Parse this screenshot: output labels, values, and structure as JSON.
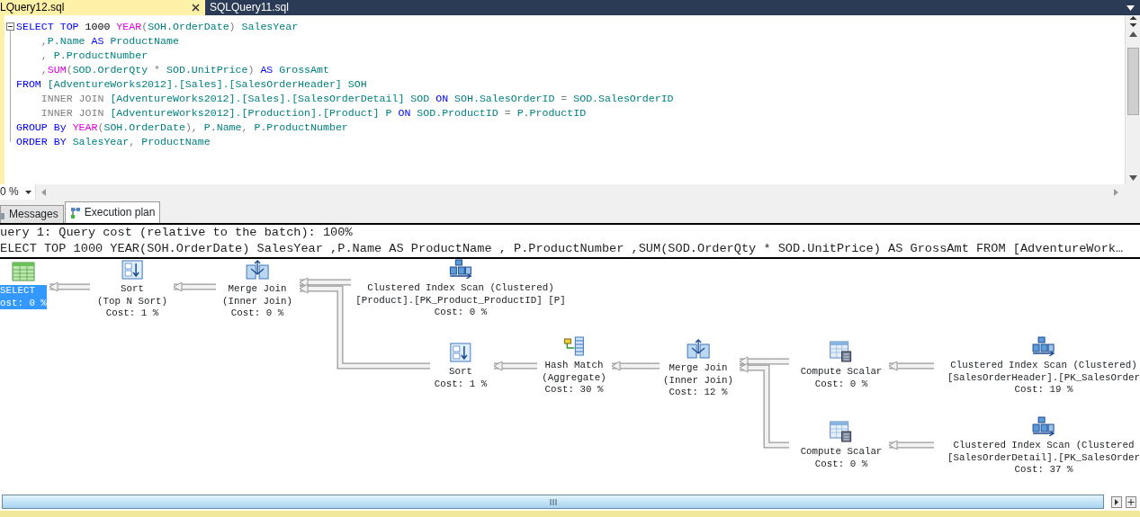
{
  "document_tabs": [
    {
      "label": "LQuery12.sql",
      "selected": true
    },
    {
      "label": "SQLQuery11.sql",
      "selected": false
    }
  ],
  "editor": {
    "lines": [
      [
        {
          "kind": "keyword",
          "text": "SELECT TOP "
        },
        {
          "kind": "plain",
          "text": "1000 "
        },
        {
          "kind": "function",
          "text": "YEAR"
        },
        {
          "kind": "punct",
          "text": "("
        },
        {
          "kind": "ident",
          "text": "SOH.OrderDate"
        },
        {
          "kind": "punct",
          "text": ")"
        },
        {
          "kind": "ident",
          "text": " SalesYear"
        }
      ],
      [
        {
          "kind": "punct",
          "text": "    ,"
        },
        {
          "kind": "ident",
          "text": "P.Name "
        },
        {
          "kind": "keyword",
          "text": "AS "
        },
        {
          "kind": "ident",
          "text": "ProductName"
        }
      ],
      [
        {
          "kind": "punct",
          "text": "    , "
        },
        {
          "kind": "ident",
          "text": "P.ProductNumber"
        }
      ],
      [
        {
          "kind": "punct",
          "text": "    ,"
        },
        {
          "kind": "function",
          "text": "SUM"
        },
        {
          "kind": "punct",
          "text": "("
        },
        {
          "kind": "ident",
          "text": "SOD.OrderQty "
        },
        {
          "kind": "punct",
          "text": "* "
        },
        {
          "kind": "ident",
          "text": "SOD.UnitPrice"
        },
        {
          "kind": "punct",
          "text": ") "
        },
        {
          "kind": "keyword",
          "text": "AS "
        },
        {
          "kind": "ident",
          "text": "GrossAmt"
        }
      ],
      [
        {
          "kind": "keyword",
          "text": "FROM "
        },
        {
          "kind": "ident",
          "text": "[AdventureWorks2012].[Sales].[SalesOrderHeader] SOH"
        }
      ],
      [
        {
          "kind": "punct",
          "text": "    INNER JOIN "
        },
        {
          "kind": "ident",
          "text": "[AdventureWorks2012].[Sales].[SalesOrderDetail] SOD "
        },
        {
          "kind": "keyword",
          "text": "ON "
        },
        {
          "kind": "ident",
          "text": "SOH.SalesOrderID "
        },
        {
          "kind": "punct",
          "text": "= "
        },
        {
          "kind": "ident",
          "text": "SOD.SalesOrderID"
        }
      ],
      [
        {
          "kind": "punct",
          "text": "    INNER JOIN "
        },
        {
          "kind": "ident",
          "text": "[AdventureWorks2012].[Production].[Product] P "
        },
        {
          "kind": "keyword",
          "text": "ON "
        },
        {
          "kind": "ident",
          "text": "SOD.ProductID "
        },
        {
          "kind": "punct",
          "text": "= "
        },
        {
          "kind": "ident",
          "text": "P.ProductID"
        }
      ],
      [
        {
          "kind": "keyword",
          "text": "GROUP By "
        },
        {
          "kind": "function",
          "text": "YEAR"
        },
        {
          "kind": "punct",
          "text": "("
        },
        {
          "kind": "ident",
          "text": "SOH.OrderDate"
        },
        {
          "kind": "punct",
          "text": "), "
        },
        {
          "kind": "ident",
          "text": "P.Name"
        },
        {
          "kind": "punct",
          "text": ", "
        },
        {
          "kind": "ident",
          "text": "P.ProductNumber"
        }
      ],
      [
        {
          "kind": "keyword",
          "text": "ORDER BY "
        },
        {
          "kind": "ident",
          "text": "SalesYear"
        },
        {
          "kind": "punct",
          "text": ", "
        },
        {
          "kind": "ident",
          "text": "ProductName"
        }
      ]
    ]
  },
  "zoom": {
    "value": "0 %"
  },
  "result_tabs": [
    {
      "label": "Messages",
      "selected": false
    },
    {
      "label": "Execution plan",
      "selected": true
    }
  ],
  "plan": {
    "header": [
      "uery 1: Query cost (relative to the batch): 100%",
      "ELECT TOP 1000 YEAR(SOH.OrderDate) SalesYear ,P.Name AS ProductName , P.ProductNumber ,SUM(SOD.OrderQty * SOD.UnitPrice) AS GrossAmt FROM [AdventureWork…"
    ],
    "root": {
      "kind": "select",
      "name": "SELECT",
      "cost": "ost: 0 %",
      "selected": true,
      "children": [
        {
          "kind": "sort",
          "name": "Sort",
          "detail": "(Top N Sort)",
          "cost": "Cost: 1 %",
          "selected": false,
          "children": [
            {
              "kind": "merge_join",
              "name": "Merge Join",
              "detail": "(Inner Join)",
              "cost": "Cost: 0 %",
              "selected": false,
              "children": [
                {
                  "kind": "index_scan",
                  "name": "Clustered Index Scan (Clustered)",
                  "detail": "[Product].[PK_Product_ProductID] [P]",
                  "cost": "Cost: 0 %",
                  "selected": false
                },
                {
                  "kind": "sort",
                  "name": "Sort",
                  "cost": "Cost: 1 %",
                  "selected": false,
                  "children": [
                    {
                      "kind": "hash_match",
                      "name": "Hash Match",
                      "detail": "(Aggregate)",
                      "cost": "Cost: 30 %",
                      "selected": false,
                      "children": [
                        {
                          "kind": "merge_join",
                          "name": "Merge Join",
                          "detail": "(Inner Join)",
                          "cost": "Cost: 12 %",
                          "selected": false,
                          "children": [
                            {
                              "kind": "compute_scalar",
                              "name": "Compute Scalar",
                              "cost": "Cost: 0 %",
                              "selected": false,
                              "children": [
                                {
                                  "kind": "index_scan",
                                  "name": "Clustered Index Scan (Clustered)",
                                  "detail": "[SalesOrderHeader].[PK_SalesOrder",
                                  "cost": "Cost: 19 %",
                                  "selected": false
                                }
                              ]
                            },
                            {
                              "kind": "compute_scalar",
                              "name": "Compute Scalar",
                              "cost": "Cost: 0 %",
                              "selected": false,
                              "children": [
                                {
                                  "kind": "index_scan",
                                  "name": "Clustered Index Scan (Clustered",
                                  "detail": "[SalesOrderDetail].[PK_SalesOrder",
                                  "cost": "Cost: 37 %",
                                  "selected": false
                                }
                              ]
                            }
                          ]
                        }
                      ]
                    }
                  ]
                }
              ]
            }
          ]
        }
      ]
    }
  }
}
